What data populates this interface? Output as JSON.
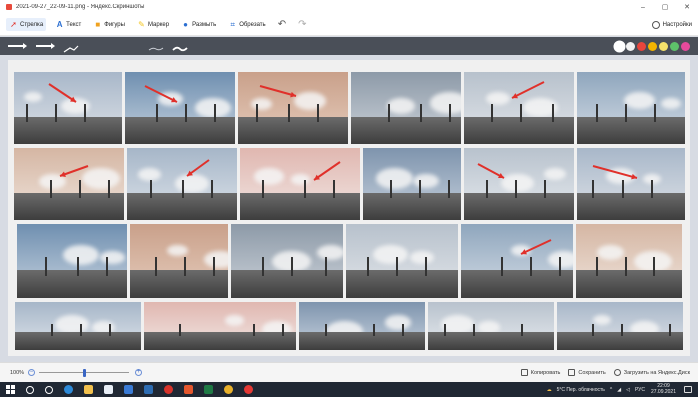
{
  "window": {
    "title": "2021-09-27_22-09-11.png - Яндекс.Скриншоты",
    "minimize": "–",
    "maximize": "▢",
    "close": "✕"
  },
  "toolbar": {
    "tools": [
      {
        "id": "arrow",
        "label": "Стрелка",
        "icon": "arrow-icon",
        "color": "#e0302a",
        "active": true
      },
      {
        "id": "text",
        "label": "Текст",
        "icon": "text-icon",
        "color": "#2a6ed1",
        "active": false
      },
      {
        "id": "shapes",
        "label": "Фигуры",
        "icon": "shapes-icon",
        "color": "#f0a21f",
        "active": false
      },
      {
        "id": "marker",
        "label": "Маркер",
        "icon": "marker-icon",
        "color": "#f3c623",
        "active": false
      },
      {
        "id": "blur",
        "label": "Размыть",
        "icon": "drop-icon",
        "color": "#2a6ed1",
        "active": false
      },
      {
        "id": "crop",
        "label": "Обрезать",
        "icon": "crop-icon",
        "color": "#2a6ed1",
        "active": false
      }
    ],
    "undo": "↶",
    "redo": "↷",
    "settings_label": "Настройки"
  },
  "colors": {
    "palette": [
      "#ffffff",
      "#f2f2f2",
      "#e8453c",
      "#f4b400",
      "#f6e26b",
      "#5ec26a",
      "#e64a9c"
    ],
    "selected": "#ffffff"
  },
  "statusbar": {
    "zoom": "100%",
    "zoom_out": "−",
    "zoom_in": "+",
    "zoom_level": 0.5,
    "actions": [
      {
        "label": "Копировать",
        "icon": "copy-icon"
      },
      {
        "label": "Сохранить",
        "icon": "save-icon"
      },
      {
        "label": "Загрузить на Яндекс.Диск",
        "icon": "cloud-upload-icon"
      }
    ]
  },
  "taskbar": {
    "weather": "5°C  Пер. облачность",
    "lang": "РУС",
    "time": "22:09",
    "date": "27.09.2021"
  }
}
